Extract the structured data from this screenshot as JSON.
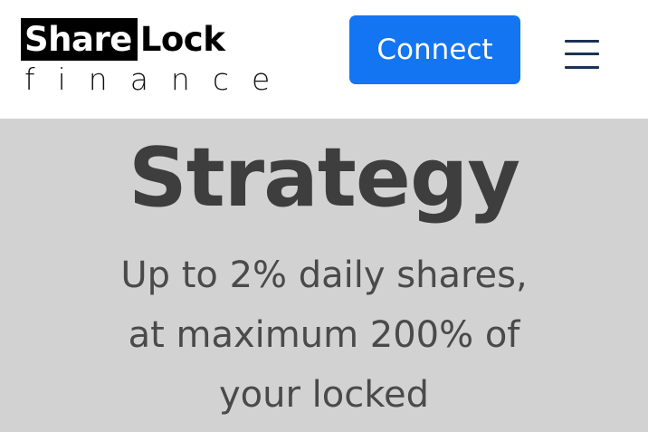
{
  "header": {
    "logo": {
      "part1": "Share",
      "part2": "Lock",
      "subtitle": "finance"
    },
    "connect_label": "Connect",
    "menu_icon": "hamburger-menu-icon"
  },
  "hero": {
    "title": "Strategy",
    "lines": [
      "Up to 2% daily shares,",
      "at maximum 200% of",
      "your locked"
    ]
  },
  "colors": {
    "accent": "#1475f2",
    "header_bg": "#ffffff",
    "hero_bg": "#d2d2d2",
    "title": "#3e3e3e",
    "menu_icon": "#1a3352"
  }
}
